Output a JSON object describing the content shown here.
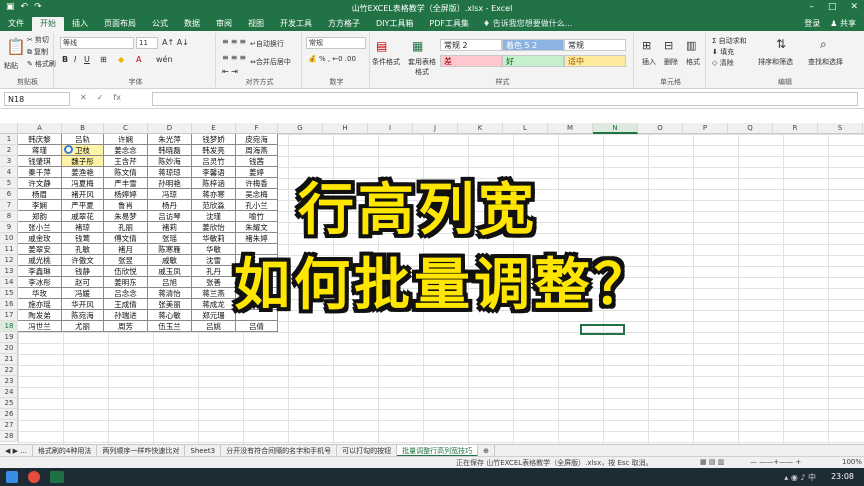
{
  "window": {
    "title": "山竹EXCEL表格教学（全屏版）.xlsx - Excel"
  },
  "tabs": [
    "文件",
    "开始",
    "插入",
    "页面布局",
    "公式",
    "数据",
    "审阅",
    "视图",
    "开发工具",
    "方方格子",
    "DIY工具箱",
    "PDF工具集"
  ],
  "active_tab": "开始",
  "tell_me": "告诉我您想要做什么...",
  "account": {
    "login": "登录",
    "share": "共享"
  },
  "ribbon": {
    "clipboard": {
      "cut": "剪切",
      "copy": "复制",
      "painter": "格式刷",
      "paste": "粘贴",
      "label": "剪贴板"
    },
    "font": {
      "name": "等线",
      "size": "11",
      "label": "字体"
    },
    "align": {
      "wrap": "自动换行",
      "merge": "合并后居中",
      "label": "对齐方式"
    },
    "number": {
      "format": "常规",
      "label": "数字"
    },
    "styles": {
      "cond": "条件格式",
      "table": "套用表格格式",
      "items": [
        "常规 2",
        "着色 5 2",
        "常规",
        "差",
        "好",
        "适中"
      ],
      "label": "样式"
    },
    "cells": {
      "insert": "插入",
      "delete": "删除",
      "format": "格式",
      "label": "单元格"
    },
    "editing": {
      "autosum": "自动求和",
      "fill": "填充",
      "clear": "清除",
      "sort": "排序和筛选",
      "find": "查找和选择",
      "label": "编辑"
    }
  },
  "formula_bar": {
    "name_box": "N18",
    "fx": "fx",
    "value": ""
  },
  "columns": [
    "A",
    "B",
    "C",
    "D",
    "E",
    "F",
    "G",
    "H",
    "I",
    "J",
    "K",
    "L",
    "M",
    "N",
    "O",
    "P",
    "Q",
    "R",
    "S"
  ],
  "selected_column": "N",
  "rows": [
    "1",
    "2",
    "3",
    "4",
    "5",
    "6",
    "7",
    "8",
    "9",
    "10",
    "11",
    "12",
    "13",
    "14",
    "15",
    "16",
    "17",
    "18",
    "19",
    "20",
    "21",
    "22",
    "23",
    "24",
    "25",
    "26",
    "27",
    "28"
  ],
  "selected_row": "18",
  "table": [
    [
      "韩庆黎",
      "吕轨",
      "许娴",
      "朱光萍",
      "钱梦娇",
      "皮宛海"
    ],
    [
      "蒋瑾",
      "卫枝",
      "姜念念",
      "韩晓磊",
      "韩发亮",
      "周海燕"
    ],
    [
      "钱肇琪",
      "魏子彤",
      "王含芹",
      "陈妙海",
      "吕灵竹",
      "钱茜"
    ],
    [
      "秦千萍",
      "姜渔艳",
      "陈文倩",
      "蒋琼琼",
      "李馨语",
      "姜婷"
    ],
    [
      "许文静",
      "冯夏梅",
      "严丰雪",
      "孙明艳",
      "陈梓涵",
      "许梅香"
    ],
    [
      "杨眉",
      "褚开风",
      "杨婷婷",
      "冯琼",
      "蒋亦寒",
      "吴念梅"
    ],
    [
      "李娴",
      "严平夏",
      "鲁肖",
      "杨丹",
      "范欣淼",
      "孔小兰"
    ],
    [
      "郑韵",
      "戚翠花",
      "朱易梦",
      "吕访琴",
      "沈瑾",
      "喻竹"
    ],
    [
      "张小兰",
      "褚琼",
      "孔丽",
      "褚莉",
      "姜欣怡",
      "朱耀文"
    ],
    [
      "戚金玫",
      "钱莺",
      "傅文倩",
      "张瑶",
      "华敏莉",
      "褚朱婷"
    ],
    [
      "姜翠安",
      "孔敏",
      "褚月",
      "陈寒雁",
      "华敏",
      ""
    ],
    [
      "戚光桃",
      "许傲文",
      "张昱",
      "戚敏",
      "沈雪",
      ""
    ],
    [
      "李鑫琳",
      "钱静",
      "伍欣悦",
      "戚玉凤",
      "孔丹",
      ""
    ],
    [
      "李冰彤",
      "赵可",
      "姜明东",
      "吕旭",
      "张善",
      ""
    ],
    [
      "华玫",
      "冯媛",
      "吕念念",
      "蒋清怡",
      "蒋兰燕",
      ""
    ],
    [
      "施亦瑶",
      "华开风",
      "王成倩",
      "张美丽",
      "蒋成龙",
      ""
    ],
    [
      "陶发弟",
      "陈宛海",
      "孙瑞进",
      "蒋心敏",
      "郑元珊",
      ""
    ],
    [
      "冯世兰",
      "尤丽",
      "周芳",
      "伍玉兰",
      "吕姚",
      "吕倩"
    ]
  ],
  "overlay": {
    "line1": "行高列宽",
    "line2": "如何批量调整？"
  },
  "sheet_tabs": [
    "格式刷的4种用法",
    "两列顺序一样咋快速比对",
    "Sheet3",
    "分开没有符合间隔的名字和手机号",
    "可以打勾的按钮",
    "批量调整行高列宽技巧"
  ],
  "active_sheet": "批量调整行高列宽技巧",
  "status": {
    "saving": "正在保存 山竹EXCEL表格教学（全屏版）.xlsx，按 Esc 取消。",
    "zoom": "100%"
  },
  "taskbar": {
    "time": "23:08"
  },
  "colors": {
    "excel_green": "#217346",
    "overlay_yellow": "#ffe600"
  }
}
